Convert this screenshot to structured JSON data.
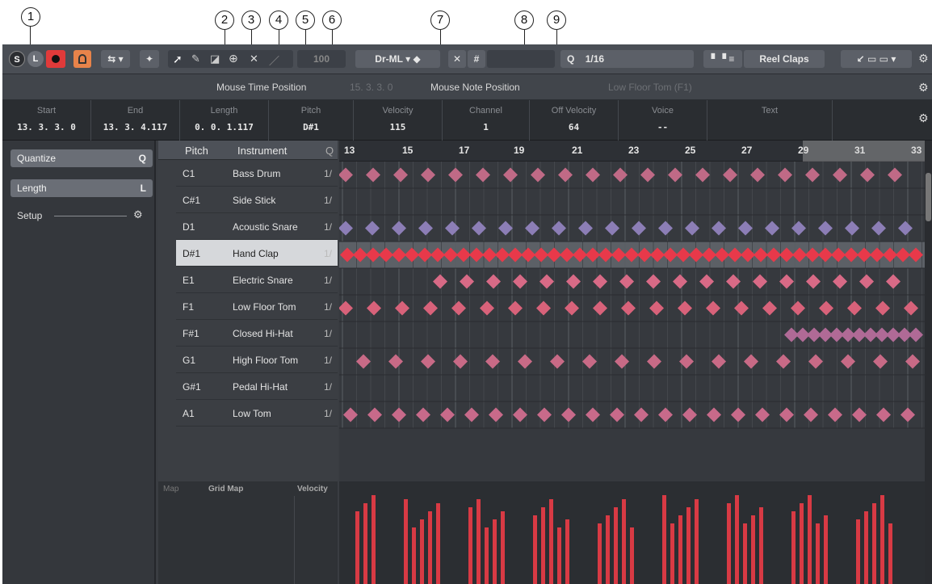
{
  "callouts": [
    "1",
    "2",
    "3",
    "4",
    "5",
    "6",
    "7",
    "8",
    "9"
  ],
  "toolbar": {
    "solo_label": "S",
    "listen_label": "L",
    "drum_map_value": "Dr-ML",
    "quantize_icon": "Q",
    "quantize_value": "1/16",
    "track_name": "Reel Claps",
    "scale_value": "100"
  },
  "infoline": {
    "mouse_time_label": "Mouse Time Position",
    "mouse_time_value": "15. 3. 3. 0",
    "mouse_note_label": "Mouse Note Position",
    "mouse_note_value": "Low Floor Tom (F1)"
  },
  "status_fields": [
    {
      "label": "Start",
      "value": "13. 3. 3.   0"
    },
    {
      "label": "End",
      "value": "13. 3. 4.117"
    },
    {
      "label": "Length",
      "value": "0. 0. 1.117"
    },
    {
      "label": "Pitch",
      "value": "D#1"
    },
    {
      "label": "Velocity",
      "value": "115"
    },
    {
      "label": "Channel",
      "value": "1"
    },
    {
      "label": "Off Velocity",
      "value": "64"
    },
    {
      "label": "Voice",
      "value": "--"
    },
    {
      "label": "Text",
      "value": ""
    }
  ],
  "inspector": {
    "quantize_label": "Quantize",
    "quantize_key": "Q",
    "length_label": "Length",
    "length_key": "L",
    "setup_label": "Setup"
  },
  "drumlist": {
    "col_pitch": "Pitch",
    "col_instrument": "Instrument",
    "col_quantize": "Q",
    "rows": [
      {
        "pitch": "C1",
        "name": "Bass Drum",
        "q": "1/"
      },
      {
        "pitch": "C#1",
        "name": "Side Stick",
        "q": "1/"
      },
      {
        "pitch": "D1",
        "name": "Acoustic Snare",
        "q": "1/"
      },
      {
        "pitch": "D#1",
        "name": "Hand Clap",
        "q": "1/"
      },
      {
        "pitch": "E1",
        "name": "Electric Snare",
        "q": "1/"
      },
      {
        "pitch": "F1",
        "name": "Low Floor Tom",
        "q": "1/"
      },
      {
        "pitch": "F#1",
        "name": "Closed Hi-Hat",
        "q": "1/"
      },
      {
        "pitch": "G1",
        "name": "High Floor Tom",
        "q": "1/"
      },
      {
        "pitch": "G#1",
        "name": "Pedal Hi-Hat",
        "q": "1/"
      },
      {
        "pitch": "A1",
        "name": "Low Tom",
        "q": "1/"
      }
    ]
  },
  "ruler": {
    "bars": [
      "13",
      "15",
      "17",
      "19",
      "21",
      "23",
      "25",
      "27",
      "29",
      "31",
      "33"
    ]
  },
  "lane": {
    "map_label": "Map",
    "grid_map_label": "Grid Map",
    "velocity_label": "Velocity"
  },
  "colors": {
    "accent_red": "#e8394a",
    "note_pink": "#c0607a",
    "note_blue": "#7d8ed8",
    "selected_row": "#d6d8db"
  }
}
